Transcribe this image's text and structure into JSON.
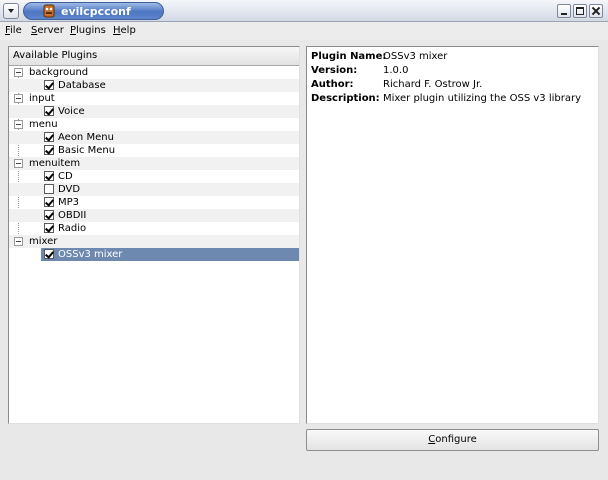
{
  "window": {
    "title": "evilcpcconf"
  },
  "menubar": {
    "items": [
      {
        "label": "File",
        "accel": "F",
        "rest": "ile"
      },
      {
        "label": "Server",
        "accel": "S",
        "rest": "erver"
      },
      {
        "label": "Plugins",
        "accel": "P",
        "rest": "lugins"
      },
      {
        "label": "Help",
        "accel": "H",
        "rest": "elp"
      }
    ]
  },
  "plugin_list": {
    "header": "Available Plugins",
    "groups": [
      {
        "name": "background",
        "plugins": [
          {
            "label": "Database",
            "checked": true
          }
        ]
      },
      {
        "name": "input",
        "plugins": [
          {
            "label": "Voice",
            "checked": true
          }
        ]
      },
      {
        "name": "menu",
        "plugins": [
          {
            "label": "Aeon Menu",
            "checked": true
          },
          {
            "label": "Basic Menu",
            "checked": true
          }
        ]
      },
      {
        "name": "menuitem",
        "plugins": [
          {
            "label": "CD",
            "checked": true
          },
          {
            "label": "DVD",
            "checked": false
          },
          {
            "label": "MP3",
            "checked": true
          },
          {
            "label": "OBDII",
            "checked": true
          },
          {
            "label": "Radio",
            "checked": true
          }
        ]
      },
      {
        "name": "mixer",
        "plugins": [
          {
            "label": "OSSv3 mixer",
            "checked": true,
            "selected": true
          }
        ]
      }
    ]
  },
  "details": {
    "plugin_name_label": "Plugin Name:",
    "plugin_name": "OSSv3 mixer",
    "version_label": "Version:",
    "version": "1.0.0",
    "author_label": "Author:",
    "author": "Richard F. Ostrow Jr.",
    "description_label": "Description:",
    "description": "Mixer plugin utilizing the OSS v3 library"
  },
  "configure": {
    "label": "Configure",
    "accel": "C",
    "rest": "onfigure"
  },
  "colors": {
    "selection": "#6d89b0",
    "title_pill": "#4d76c2"
  }
}
